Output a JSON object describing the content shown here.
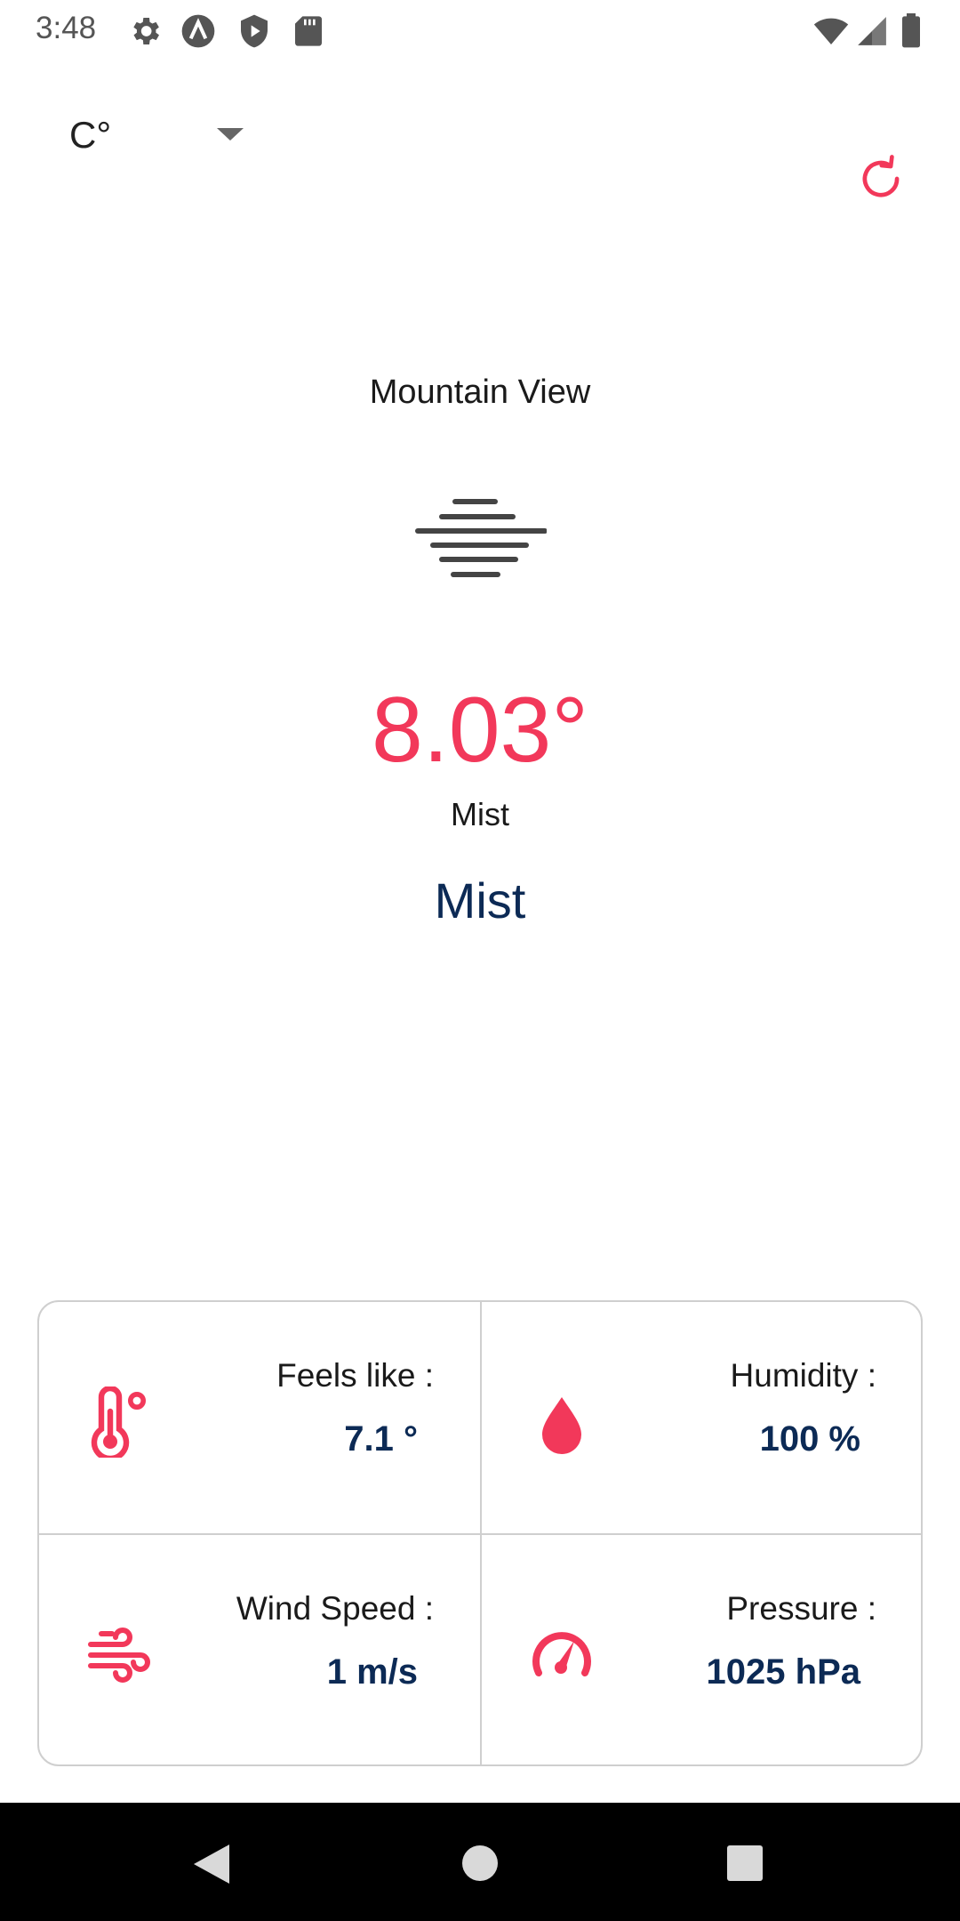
{
  "status_bar": {
    "time": "3:48",
    "icons": [
      "settings-icon",
      "app-a-icon",
      "play-protect-icon",
      "sd-card-icon",
      "wifi-icon",
      "cell-signal-icon",
      "battery-icon"
    ]
  },
  "unit_selector": {
    "selected": "C°"
  },
  "refresh": {
    "icon": "refresh-icon",
    "color": "#f2385a"
  },
  "weather": {
    "city": "Mountain View",
    "icon": "mist-icon",
    "temperature": "8.03°",
    "description_small": "Mist",
    "description_large": "Mist"
  },
  "details": {
    "feels_like": {
      "label": "Feels like :",
      "value": "7.1 °",
      "icon": "thermometer-icon"
    },
    "humidity": {
      "label": "Humidity :",
      "value": "100 %",
      "icon": "water-drop-icon"
    },
    "wind_speed": {
      "label": "Wind Speed :",
      "value": "1 m/s",
      "icon": "wind-icon"
    },
    "pressure": {
      "label": "Pressure :",
      "value": "1025 hPa",
      "icon": "gauge-icon"
    }
  },
  "colors": {
    "accent": "#f2385a",
    "navy": "#0c2a55"
  },
  "nav_bar": {
    "buttons": [
      "back-button",
      "home-button",
      "recents-button"
    ]
  }
}
